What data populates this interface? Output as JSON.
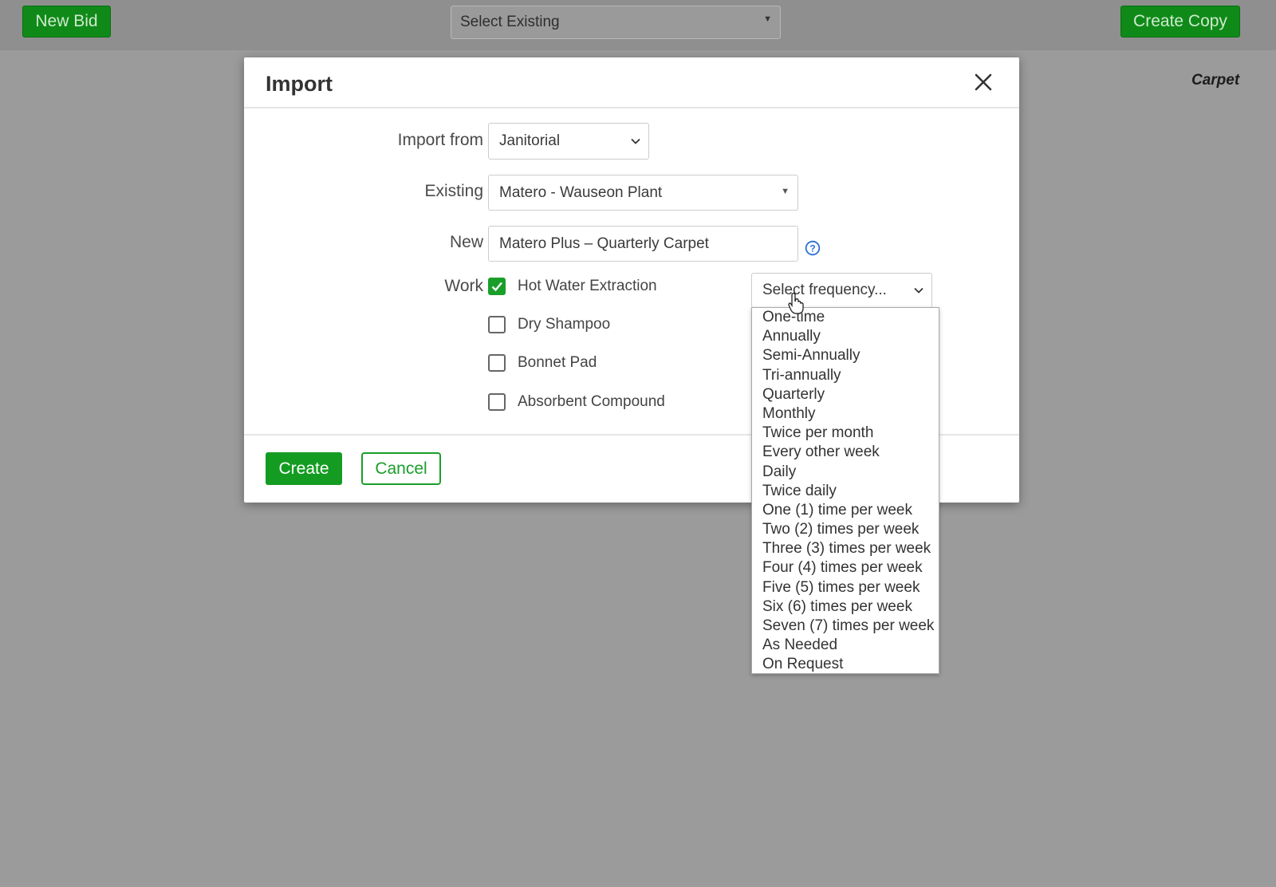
{
  "topbar": {
    "new_bid_label": "New Bid",
    "select_existing_label": "Select Existing",
    "create_copy_label": "Create Copy",
    "section_label": "Carpet"
  },
  "modal": {
    "title": "Import",
    "import_from": {
      "label": "Import from",
      "value": "Janitorial"
    },
    "existing": {
      "label": "Existing",
      "value": "Matero - Wauseon Plant"
    },
    "new": {
      "label": "New",
      "value": "Matero Plus – Quarterly Carpet"
    },
    "work": {
      "label": "Work",
      "items": [
        {
          "label": "Hot Water Extraction",
          "checked": true
        },
        {
          "label": "Dry Shampoo",
          "checked": false
        },
        {
          "label": "Bonnet Pad",
          "checked": false
        },
        {
          "label": "Absorbent Compound",
          "checked": false
        }
      ]
    },
    "frequency": {
      "placeholder": "Select frequency...",
      "options": [
        "One-time",
        "Annually",
        "Semi-Annually",
        "Tri-annually",
        "Quarterly",
        "Monthly",
        "Twice per month",
        "Every other week",
        "Daily",
        "Twice daily",
        "One (1) time per week",
        "Two (2) times per week",
        "Three (3) times per week",
        "Four (4) times per week",
        "Five (5) times per week",
        "Six (6) times per week",
        "Seven (7) times per week",
        "As Needed",
        "On Request"
      ]
    },
    "create_label": "Create",
    "cancel_label": "Cancel"
  },
  "colors": {
    "accent_green": "#149c22",
    "overlay": "#9b9b9b"
  }
}
